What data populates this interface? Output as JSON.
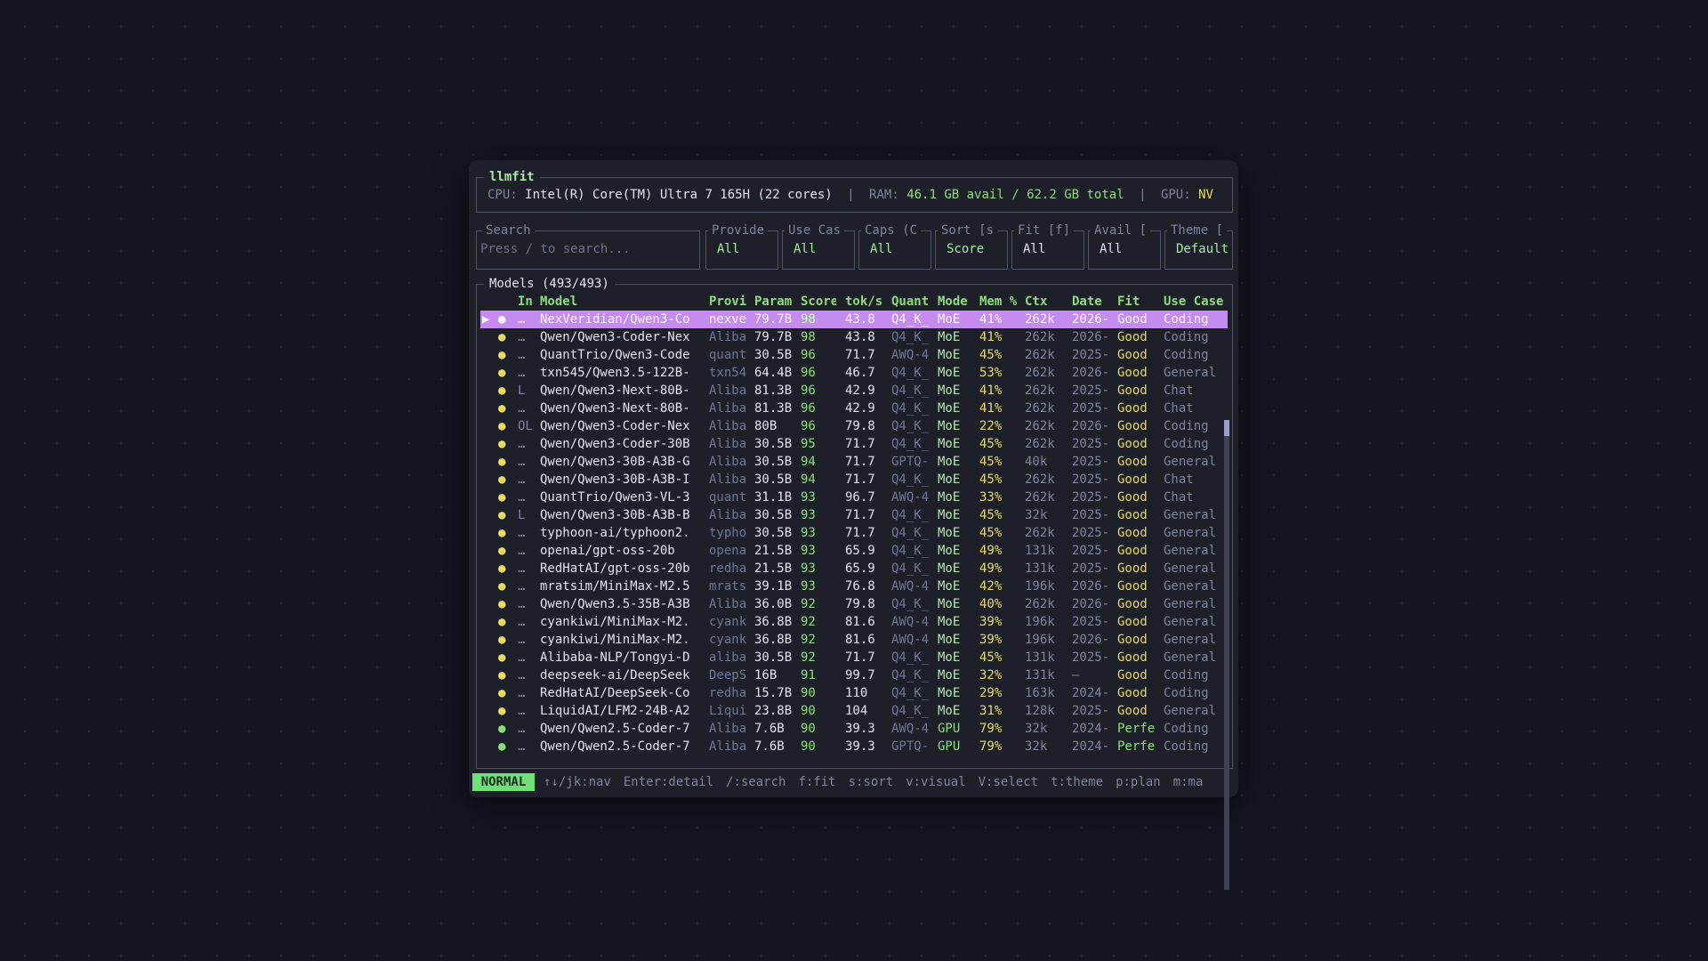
{
  "app": {
    "title": "llmfit",
    "cpu_label": "CPU:",
    "cpu_value": "Intel(R) Core(TM) Ultra 7 165H (22 cores)",
    "ram_label": "RAM:",
    "ram_value": "46.1 GB avail / 62.2 GB total",
    "gpu_label": "GPU:",
    "gpu_value": "NV",
    "separator": "|"
  },
  "filters": {
    "search": {
      "label": "Search",
      "placeholder": "Press / to search..."
    },
    "items": [
      {
        "label": "Provide",
        "value": "All"
      },
      {
        "label": "Use Cas",
        "value": "All"
      },
      {
        "label": "Caps (C",
        "value": "All"
      },
      {
        "label": "Sort [s",
        "value": "Score"
      },
      {
        "label": "Fit [f]",
        "value": "All"
      },
      {
        "label": "Avail [",
        "value": "All"
      },
      {
        "label": "Theme [",
        "value": "Default"
      }
    ]
  },
  "models": {
    "title": "Models (493/493)",
    "columns": {
      "inst": "In",
      "model": "Model",
      "prov": "Provi",
      "param": "Param",
      "score": "Score",
      "tok": "tok/s",
      "quant": "Quant",
      "mode": "Mode",
      "mem": "Mem %",
      "ctx": "Ctx",
      "date": "Date",
      "fit": "Fit",
      "use": "Use Case"
    },
    "rows": [
      {
        "mark": "▶",
        "dot": "●",
        "inst": "…",
        "model": "NexVeridian/Qwen3-Co",
        "prov": "nexve",
        "param": "79.7B",
        "score": "98",
        "tok": "43.8",
        "quant": "Q4_K_",
        "mode": "MoE",
        "mem": "41%",
        "ctx": "262k",
        "date": "2026-",
        "fit": "Good",
        "use": "Coding"
      },
      {
        "mark": "",
        "dot": "●",
        "inst": "…",
        "model": "Qwen/Qwen3-Coder-Nex",
        "prov": "Aliba",
        "param": "79.7B",
        "score": "98",
        "tok": "43.8",
        "quant": "Q4_K_",
        "mode": "MoE",
        "mem": "41%",
        "ctx": "262k",
        "date": "2026-",
        "fit": "Good",
        "use": "Coding"
      },
      {
        "mark": "",
        "dot": "●",
        "inst": "…",
        "model": "QuantTrio/Qwen3-Code",
        "prov": "quant",
        "param": "30.5B",
        "score": "96",
        "tok": "71.7",
        "quant": "AWQ-4",
        "mode": "MoE",
        "mem": "45%",
        "ctx": "262k",
        "date": "2025-",
        "fit": "Good",
        "use": "Coding"
      },
      {
        "mark": "",
        "dot": "●",
        "inst": "…",
        "model": "txn545/Qwen3.5-122B-",
        "prov": "txn54",
        "param": "64.4B",
        "score": "96",
        "tok": "46.7",
        "quant": "Q4_K_",
        "mode": "MoE",
        "mem": "53%",
        "ctx": "262k",
        "date": "2026-",
        "fit": "Good",
        "use": "General"
      },
      {
        "mark": "",
        "dot": "●",
        "inst": "L",
        "model": "Qwen/Qwen3-Next-80B-",
        "prov": "Aliba",
        "param": "81.3B",
        "score": "96",
        "tok": "42.9",
        "quant": "Q4_K_",
        "mode": "MoE",
        "mem": "41%",
        "ctx": "262k",
        "date": "2025-",
        "fit": "Good",
        "use": "Chat"
      },
      {
        "mark": "",
        "dot": "●",
        "inst": "…",
        "model": "Qwen/Qwen3-Next-80B-",
        "prov": "Aliba",
        "param": "81.3B",
        "score": "96",
        "tok": "42.9",
        "quant": "Q4_K_",
        "mode": "MoE",
        "mem": "41%",
        "ctx": "262k",
        "date": "2025-",
        "fit": "Good",
        "use": "Chat"
      },
      {
        "mark": "",
        "dot": "●",
        "inst": "OL",
        "model": "Qwen/Qwen3-Coder-Nex",
        "prov": "Aliba",
        "param": "80B",
        "score": "96",
        "tok": "79.8",
        "quant": "Q4_K_",
        "mode": "MoE",
        "mem": "22%",
        "ctx": "262k",
        "date": "2026-",
        "fit": "Good",
        "use": "Coding"
      },
      {
        "mark": "",
        "dot": "●",
        "inst": "…",
        "model": "Qwen/Qwen3-Coder-30B",
        "prov": "Aliba",
        "param": "30.5B",
        "score": "95",
        "tok": "71.7",
        "quant": "Q4_K_",
        "mode": "MoE",
        "mem": "45%",
        "ctx": "262k",
        "date": "2025-",
        "fit": "Good",
        "use": "Coding"
      },
      {
        "mark": "",
        "dot": "●",
        "inst": "…",
        "model": "Qwen/Qwen3-30B-A3B-G",
        "prov": "Aliba",
        "param": "30.5B",
        "score": "94",
        "tok": "71.7",
        "quant": "GPTQ-",
        "mode": "MoE",
        "mem": "45%",
        "ctx": "40k",
        "date": "2025-",
        "fit": "Good",
        "use": "General"
      },
      {
        "mark": "",
        "dot": "●",
        "inst": "…",
        "model": "Qwen/Qwen3-30B-A3B-I",
        "prov": "Aliba",
        "param": "30.5B",
        "score": "94",
        "tok": "71.7",
        "quant": "Q4_K_",
        "mode": "MoE",
        "mem": "45%",
        "ctx": "262k",
        "date": "2025-",
        "fit": "Good",
        "use": "Chat"
      },
      {
        "mark": "",
        "dot": "●",
        "inst": "…",
        "model": "QuantTrio/Qwen3-VL-3",
        "prov": "quant",
        "param": "31.1B",
        "score": "93",
        "tok": "96.7",
        "quant": "AWQ-4",
        "mode": "MoE",
        "mem": "33%",
        "ctx": "262k",
        "date": "2025-",
        "fit": "Good",
        "use": "Chat"
      },
      {
        "mark": "",
        "dot": "●",
        "inst": "L",
        "model": "Qwen/Qwen3-30B-A3B-B",
        "prov": "Aliba",
        "param": "30.5B",
        "score": "93",
        "tok": "71.7",
        "quant": "Q4_K_",
        "mode": "MoE",
        "mem": "45%",
        "ctx": "32k",
        "date": "2025-",
        "fit": "Good",
        "use": "General"
      },
      {
        "mark": "",
        "dot": "●",
        "inst": "…",
        "model": "typhoon-ai/typhoon2.",
        "prov": "typho",
        "param": "30.5B",
        "score": "93",
        "tok": "71.7",
        "quant": "Q4_K_",
        "mode": "MoE",
        "mem": "45%",
        "ctx": "262k",
        "date": "2025-",
        "fit": "Good",
        "use": "General"
      },
      {
        "mark": "",
        "dot": "●",
        "inst": "…",
        "model": "openai/gpt-oss-20b",
        "prov": "opena",
        "param": "21.5B",
        "score": "93",
        "tok": "65.9",
        "quant": "Q4_K_",
        "mode": "MoE",
        "mem": "49%",
        "ctx": "131k",
        "date": "2025-",
        "fit": "Good",
        "use": "General"
      },
      {
        "mark": "",
        "dot": "●",
        "inst": "…",
        "model": "RedHatAI/gpt-oss-20b",
        "prov": "redha",
        "param": "21.5B",
        "score": "93",
        "tok": "65.9",
        "quant": "Q4_K_",
        "mode": "MoE",
        "mem": "49%",
        "ctx": "131k",
        "date": "2025-",
        "fit": "Good",
        "use": "General"
      },
      {
        "mark": "",
        "dot": "●",
        "inst": "…",
        "model": "mratsim/MiniMax-M2.5",
        "prov": "mrats",
        "param": "39.1B",
        "score": "93",
        "tok": "76.8",
        "quant": "AWQ-4",
        "mode": "MoE",
        "mem": "42%",
        "ctx": "196k",
        "date": "2026-",
        "fit": "Good",
        "use": "General"
      },
      {
        "mark": "",
        "dot": "●",
        "inst": "…",
        "model": "Qwen/Qwen3.5-35B-A3B",
        "prov": "Aliba",
        "param": "36.0B",
        "score": "92",
        "tok": "79.8",
        "quant": "Q4_K_",
        "mode": "MoE",
        "mem": "40%",
        "ctx": "262k",
        "date": "2026-",
        "fit": "Good",
        "use": "General"
      },
      {
        "mark": "",
        "dot": "●",
        "inst": "…",
        "model": "cyankiwi/MiniMax-M2.",
        "prov": "cyank",
        "param": "36.8B",
        "score": "92",
        "tok": "81.6",
        "quant": "AWQ-4",
        "mode": "MoE",
        "mem": "39%",
        "ctx": "196k",
        "date": "2025-",
        "fit": "Good",
        "use": "General"
      },
      {
        "mark": "",
        "dot": "●",
        "inst": "…",
        "model": "cyankiwi/MiniMax-M2.",
        "prov": "cyank",
        "param": "36.8B",
        "score": "92",
        "tok": "81.6",
        "quant": "AWQ-4",
        "mode": "MoE",
        "mem": "39%",
        "ctx": "196k",
        "date": "2026-",
        "fit": "Good",
        "use": "General"
      },
      {
        "mark": "",
        "dot": "●",
        "inst": "…",
        "model": "Alibaba-NLP/Tongyi-D",
        "prov": "aliba",
        "param": "30.5B",
        "score": "92",
        "tok": "71.7",
        "quant": "Q4_K_",
        "mode": "MoE",
        "mem": "45%",
        "ctx": "131k",
        "date": "2025-",
        "fit": "Good",
        "use": "General"
      },
      {
        "mark": "",
        "dot": "●",
        "inst": "…",
        "model": "deepseek-ai/DeepSeek",
        "prov": "DeepS",
        "param": "16B",
        "score": "91",
        "tok": "99.7",
        "quant": "Q4_K_",
        "mode": "MoE",
        "mem": "32%",
        "ctx": "131k",
        "date": "—",
        "fit": "Good",
        "use": "Coding"
      },
      {
        "mark": "",
        "dot": "●",
        "inst": "…",
        "model": "RedHatAI/DeepSeek-Co",
        "prov": "redha",
        "param": "15.7B",
        "score": "90",
        "tok": "110",
        "quant": "Q4_K_",
        "mode": "MoE",
        "mem": "29%",
        "ctx": "163k",
        "date": "2024-",
        "fit": "Good",
        "use": "Coding"
      },
      {
        "mark": "",
        "dot": "●",
        "inst": "…",
        "model": "LiquidAI/LFM2-24B-A2",
        "prov": "Liqui",
        "param": "23.8B",
        "score": "90",
        "tok": "104",
        "quant": "Q4_K_",
        "mode": "MoE",
        "mem": "31%",
        "ctx": "128k",
        "date": "2025-",
        "fit": "Good",
        "use": "General"
      },
      {
        "mark": "",
        "dot": "●",
        "inst": "…",
        "model": "Qwen/Qwen2.5-Coder-7",
        "prov": "Aliba",
        "param": "7.6B",
        "score": "90",
        "tok": "39.3",
        "quant": "AWQ-4",
        "mode": "GPU",
        "mem": "79%",
        "ctx": "32k",
        "date": "2024-",
        "fit": "Perfe",
        "use": "Coding"
      },
      {
        "mark": "",
        "dot": "●",
        "inst": "…",
        "model": "Qwen/Qwen2.5-Coder-7",
        "prov": "Aliba",
        "param": "7.6B",
        "score": "90",
        "tok": "39.3",
        "quant": "GPTQ-",
        "mode": "GPU",
        "mem": "79%",
        "ctx": "32k",
        "date": "2024-",
        "fit": "Perfe",
        "use": "Coding"
      }
    ]
  },
  "status": {
    "mode": "NORMAL",
    "hints": [
      "↑↓/jk:nav",
      "Enter:detail",
      "/:search",
      "f:fit",
      "s:sort",
      "v:visual",
      "V:select",
      "t:theme",
      "p:plan",
      "m:ma"
    ]
  },
  "colors": {
    "accent": "#8fdc7e",
    "selection": "#c58cf0",
    "warning": "#e8dc66",
    "background": "#131620",
    "panel": "#1d2029"
  }
}
